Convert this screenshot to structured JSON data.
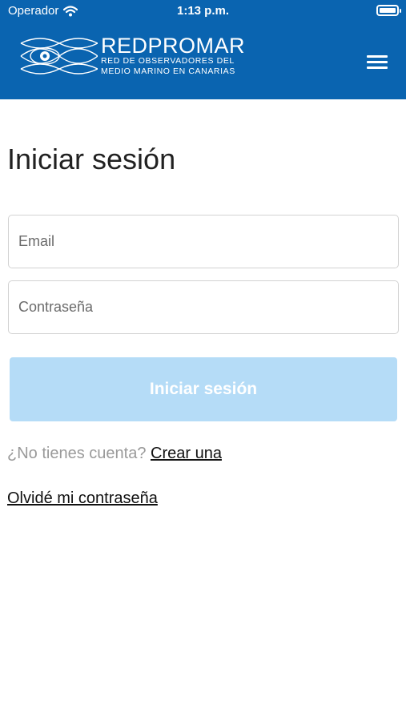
{
  "status_bar": {
    "carrier": "Operador",
    "time": "1:13 p.m.",
    "wifi_icon": "wifi-icon",
    "battery_icon": "battery-icon"
  },
  "header": {
    "logo_title": "REDPROMAR",
    "logo_subtitle_line1": "RED DE OBSERVADORES DEL",
    "logo_subtitle_line2": "MEDIO MARINO EN CANARIAS",
    "menu_icon": "hamburger-menu-icon",
    "background_color": "#0a64b0"
  },
  "login": {
    "title": "Iniciar sesión",
    "email_placeholder": "Email",
    "password_placeholder": "Contraseña",
    "submit_label": "Iniciar sesión",
    "submit_color": "#b5dcf7",
    "no_account_text": "¿No tienes cuenta?",
    "create_account_link": "Crear una",
    "forgot_password_link": "Olvidé mi contraseña"
  }
}
